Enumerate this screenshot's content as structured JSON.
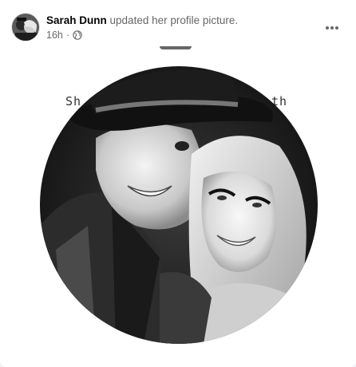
{
  "post": {
    "author": "Sarah Dunn",
    "action": "updated her profile picture.",
    "timestamp": "16h",
    "separator": "·",
    "privacy_icon": "globe-icon",
    "more_icon": "more-horizontal-icon"
  },
  "photo": {
    "background_text_left": "Sh",
    "background_text_right": "th"
  },
  "colors": {
    "secondary_text": "#65676b",
    "page_background": "#f0f2f5"
  }
}
